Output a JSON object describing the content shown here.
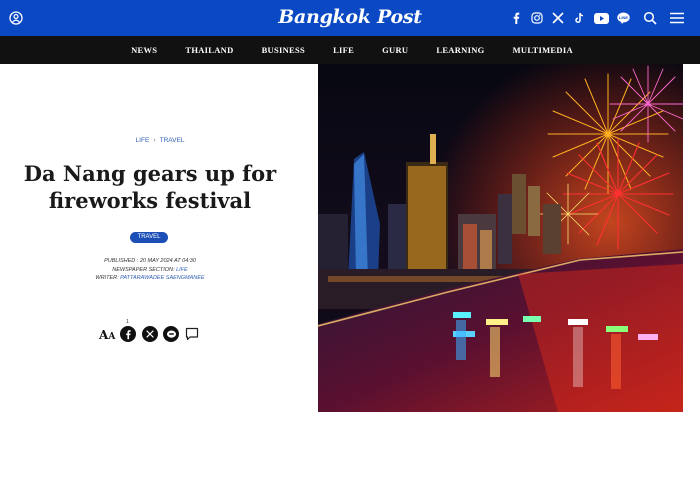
{
  "header": {
    "logo_text": "Bangkok Post",
    "brand_color": "#0a48c4",
    "icons": [
      "user-icon",
      "facebook-icon",
      "instagram-icon",
      "x-icon",
      "tiktok-icon",
      "youtube-icon",
      "line-icon",
      "search-icon",
      "menu-icon"
    ]
  },
  "nav": {
    "items": [
      "NEWS",
      "THAILAND",
      "BUSINESS",
      "LIFE",
      "GURU",
      "LEARNING",
      "MULTIMEDIA"
    ]
  },
  "article": {
    "breadcrumb": [
      "LIFE",
      "TRAVEL"
    ],
    "breadcrumb_separator": "›",
    "title_line1": "Da Nang gears up for",
    "title_line2": "fireworks festival",
    "tag": "TRAVEL",
    "published_label": "PUBLISHED : 20 MAY 2024 AT 04:30",
    "section_label": "NEWSPAPER SECTION: ",
    "section_value": "LIFE",
    "writer_label": "WRITER: ",
    "writer_value": "PATTARAWADEE SAENGMANEE",
    "share_count": "1",
    "font_size_label": "A"
  },
  "hero_image": {
    "description": "Da Nang skyline at night with fireworks over the river"
  }
}
